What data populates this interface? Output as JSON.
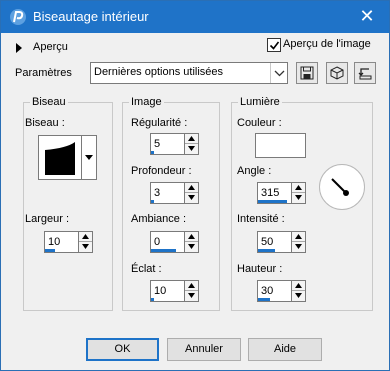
{
  "window": {
    "title": "Biseautage intérieur",
    "close_glyph": "✕",
    "accent_color": "#1f73c8"
  },
  "preview": {
    "toggle_label": "Aperçu",
    "toggle_icon": "triangle-right-icon",
    "image_preview_label": "Aperçu de l'image",
    "image_preview_checked": true
  },
  "params": {
    "label": "Paramètres",
    "selected": "Dernières options utilisées",
    "tool_icons": [
      "save-preset-icon",
      "reset-cube-icon",
      "restore-icon"
    ]
  },
  "bevel_group": {
    "title": "Biseau",
    "bevel_label": "Biseau :",
    "width_label": "Largeur :",
    "width_value": "10",
    "width_fill": 0.3
  },
  "image_group": {
    "title": "Image",
    "regularity_label": "Régularité :",
    "regularity_value": "5",
    "regularity_fill": 0.1,
    "depth_label": "Profondeur :",
    "depth_value": "3",
    "depth_fill": 0.1,
    "ambiance_label": "Ambiance :",
    "ambiance_value": "0",
    "ambiance_fill": 0.75,
    "eclat_label": "Éclat :",
    "eclat_value": "10",
    "eclat_fill": 0.1
  },
  "light_group": {
    "title": "Lumière",
    "color_label": "Couleur :",
    "color_value": "#ffffff",
    "angle_label": "Angle :",
    "angle_value": "315",
    "angle_fill": 0.88,
    "intensity_label": "Intensité :",
    "intensity_value": "50",
    "intensity_fill": 0.5,
    "height_label": "Hauteur :",
    "height_value": "30",
    "height_fill": 0.35
  },
  "buttons": {
    "ok": "OK",
    "cancel": "Annuler",
    "help": "Aide"
  }
}
